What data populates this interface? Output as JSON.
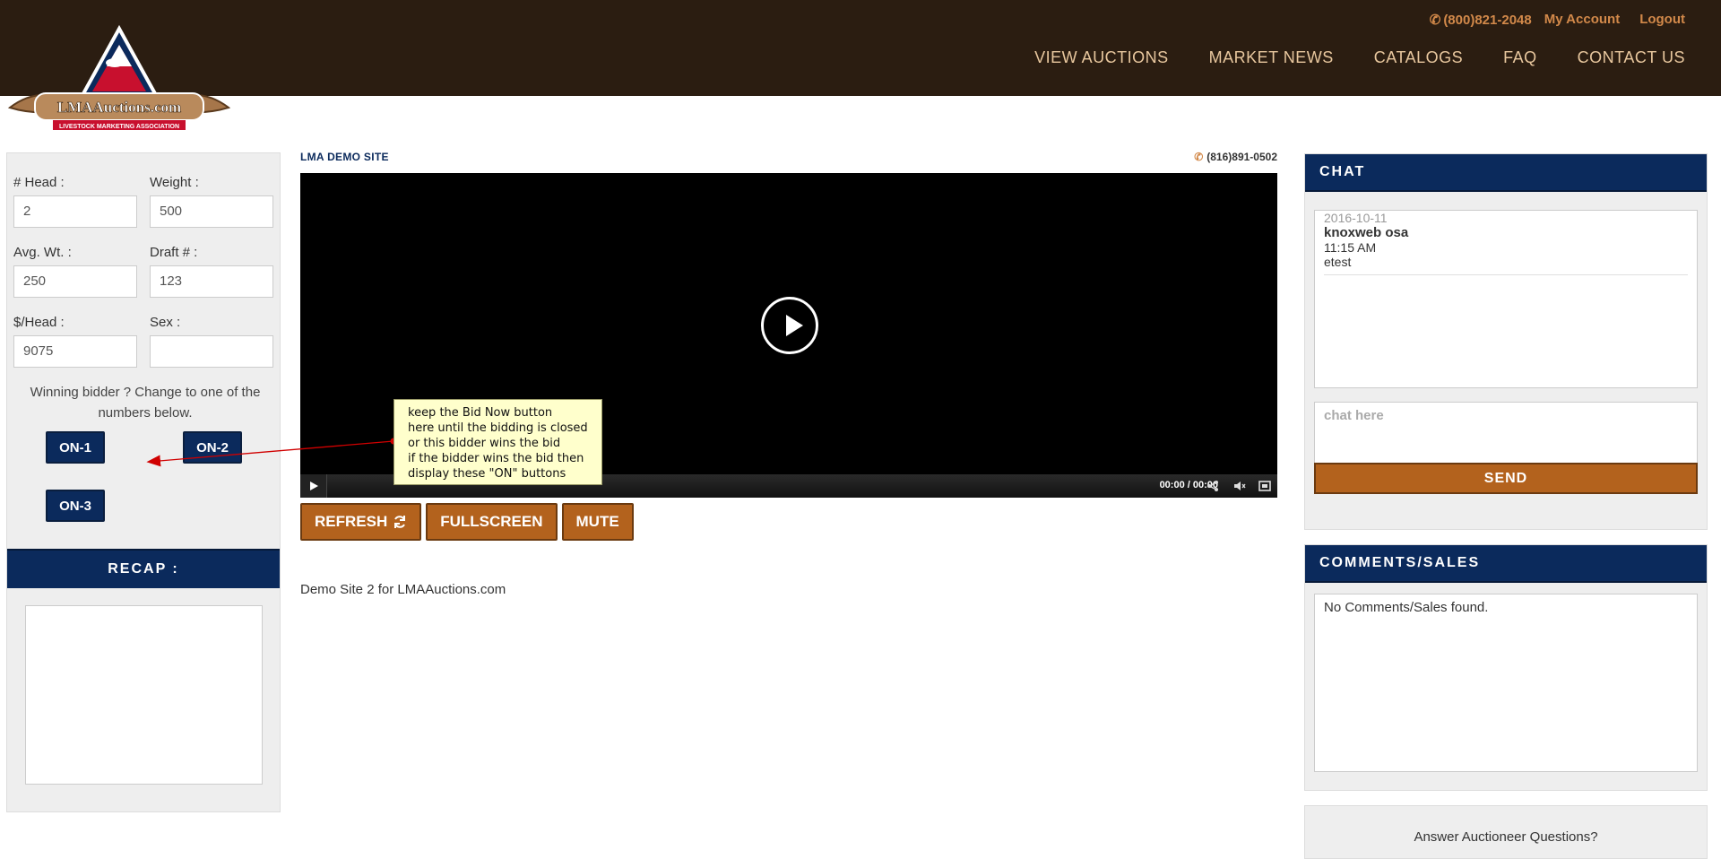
{
  "header": {
    "phone": "(800)821-2048",
    "my_account": "My Account",
    "logout": "Logout",
    "nav": [
      "VIEW AUCTIONS",
      "MARKET NEWS",
      "CATALOGS",
      "FAQ",
      "CONTACT US"
    ]
  },
  "logo": {
    "text": "LMAAuctions.com",
    "tagline": "LIVESTOCK MARKETING ASSOCIATION"
  },
  "lot": {
    "head_label": "# Head :",
    "head_value": "2",
    "weight_label": "Weight :",
    "weight_value": "500",
    "avgwt_label": "Avg. Wt. :",
    "avgwt_value": "250",
    "draft_label": "Draft # :",
    "draft_value": "123",
    "perhead_label": "$/Head :",
    "perhead_value": "9075",
    "sex_label": "Sex :",
    "sex_value": ""
  },
  "winning_text": "Winning bidder ? Change to one of the numbers below.",
  "on_buttons": [
    "ON-1",
    "ON-2",
    "ON-3"
  ],
  "recap_label": "RECAP :",
  "site": {
    "title": "LMA DEMO SITE",
    "phone": "(816)891-0502",
    "time": "00:00 / 00:00",
    "demo_text": "Demo Site 2 for LMAAuctions.com"
  },
  "tooltip": "keep the Bid Now button\nhere until the bidding is closed\nor this bidder wins the bid\nif the bidder wins the bid then\ndisplay these \"ON\" buttons",
  "buttons": {
    "refresh": "REFRESH",
    "fullscreen": "FULLSCREEN",
    "mute": "MUTE"
  },
  "chat": {
    "title": "CHAT",
    "messages": [
      {
        "date": "2016-10-11",
        "user": "knoxweb osa",
        "time": "11:15 AM",
        "text": "etest"
      }
    ],
    "placeholder": "chat here",
    "send": "SEND"
  },
  "comments": {
    "title": "COMMENTS/SALES",
    "empty": "No Comments/Sales found."
  },
  "answer_text": "Answer Auctioneer Questions?",
  "colors": {
    "header_bg": "#2b1d11",
    "navy": "#0b2a5c",
    "orange": "#b3621d",
    "link": "#d2894a"
  },
  "icons": [
    "phone-icon",
    "refresh-icon",
    "play-icon",
    "share-icon",
    "volume-icon",
    "fullscreen-icon"
  ]
}
